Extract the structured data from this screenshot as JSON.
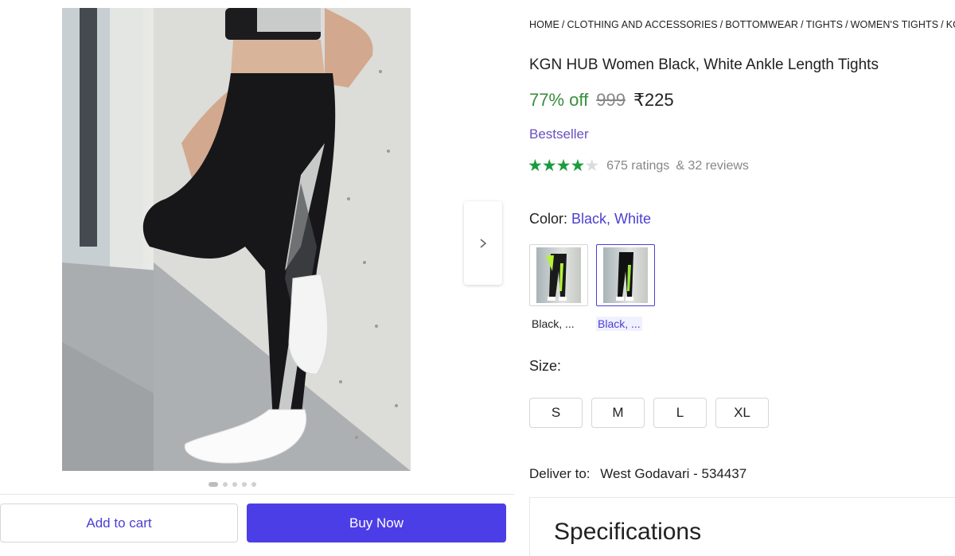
{
  "breadcrumb": [
    "HOME",
    "CLOTHING AND ACCESSORIES",
    "BOTTOMWEAR",
    "TIGHTS",
    "WOMEN'S TIGHTS",
    "KGN"
  ],
  "product": {
    "title": "KGN HUB Women Black, White Ankle Length Tights",
    "discount": "77% off",
    "mrp": "999",
    "price": "₹225",
    "badge": "Bestseller",
    "rating_stars": 4,
    "ratings_text": "675 ratings",
    "reviews_text": "& 32 reviews"
  },
  "color": {
    "label": "Color:",
    "selected_value": "Black, White",
    "options": [
      "Black, ...",
      "Black, ..."
    ]
  },
  "size": {
    "label": "Size:",
    "options": [
      "S",
      "M",
      "L",
      "XL"
    ]
  },
  "delivery": {
    "label": "Deliver to:",
    "location": "West Godavari - 534437"
  },
  "specifications": {
    "title": "Specifications"
  },
  "actions": {
    "add_to_cart": "Add to cart",
    "buy_now": "Buy Now"
  },
  "gallery": {
    "image_count": 5,
    "active_index": 0
  },
  "icons": {
    "next": "chevron-right-icon",
    "star": "star-icon"
  },
  "colors": {
    "accent": "#4c3ee6",
    "discount": "#388e3c",
    "star": "#1a9c3e",
    "bestseller": "#6a4fbf"
  }
}
